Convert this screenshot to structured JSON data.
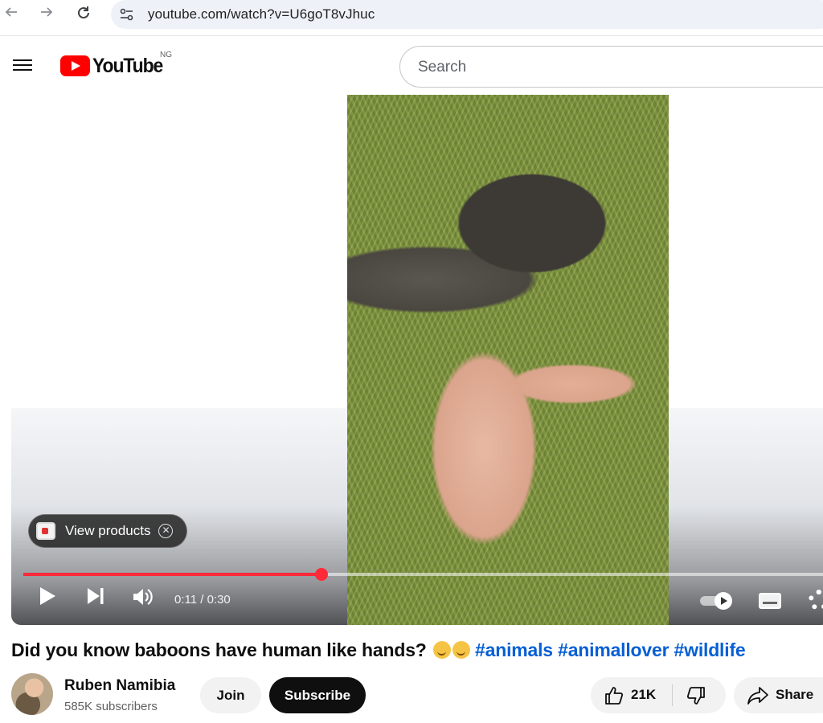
{
  "browser": {
    "url": "youtube.com/watch?v=U6goT8vJhuc",
    "back_icon": "arrow-left-icon",
    "forward_icon": "arrow-right-icon",
    "reload_icon": "reload-icon"
  },
  "masthead": {
    "logo_text": "YouTube",
    "region_code": "NG",
    "search_placeholder": "Search"
  },
  "player": {
    "products_chip_label": "View products",
    "time": "0:11 / 0:30",
    "progress_fraction": 0.367,
    "autoplay": true
  },
  "video": {
    "title": "Did you know baboons have human like hands?",
    "hashtags": [
      "#animals",
      "#animallover",
      "#wildlife"
    ]
  },
  "channel": {
    "name": "Ruben Namibia",
    "subscribers": "585K subscribers",
    "join_label": "Join",
    "subscribe_label": "Subscribe"
  },
  "actions": {
    "like_count": "21K",
    "share_label": "Share"
  },
  "colors": {
    "brand_red": "#ff0000",
    "progress_red": "#ff2a3a",
    "link_blue": "#065fd4"
  }
}
